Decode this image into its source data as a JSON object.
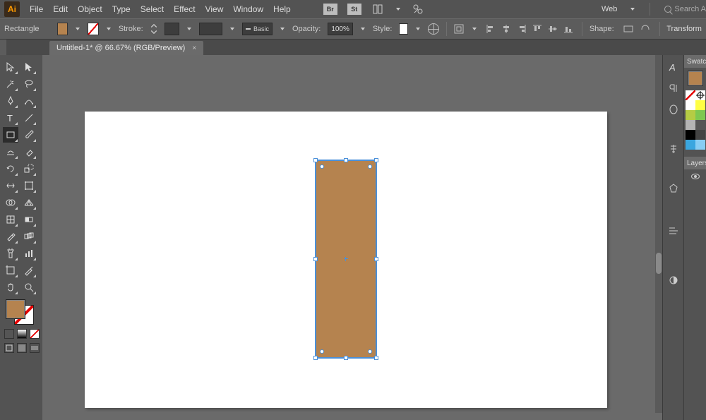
{
  "app_logo": "Ai",
  "menus": [
    "File",
    "Edit",
    "Object",
    "Type",
    "Select",
    "Effect",
    "View",
    "Window",
    "Help"
  ],
  "menu_icons": [
    "Br",
    "St"
  ],
  "workspace_mode": "Web",
  "search_placeholder": "Search A",
  "ctrlbar": {
    "shape_label": "Rectangle",
    "stroke_label": "Stroke:",
    "stroke_style": "Basic",
    "opacity_label": "Opacity:",
    "opacity_value": "100%",
    "style_label": "Style:",
    "shape_section": "Shape:",
    "transform": "Transform",
    "fill_color": "#b5834f"
  },
  "tab": {
    "title": "Untitled-1* @ 66.67% (RGB/Preview)",
    "close": "×"
  },
  "panels": {
    "swatches": "Swatc",
    "layers": "Layers"
  },
  "swatches": [
    "#ffffff",
    "#ffff44",
    "#b5cc44",
    "#7ec850",
    "#b4b4b4",
    "#565656",
    "#000000",
    "#444444",
    "#3aa6df",
    "#88cdf4"
  ],
  "selection": {
    "fill": "#b5834f"
  }
}
